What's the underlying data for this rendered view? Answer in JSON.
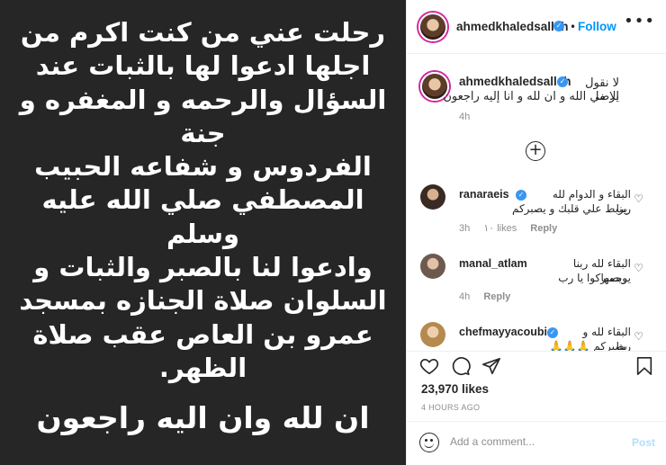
{
  "post": {
    "image_text": [
      "رحلت عني من كنت اكرم من",
      "اجلها ادعوا لها بالثبات عند",
      "السؤال والرحمه و المغفره و جنة",
      "الفردوس و شفاعه الحبيب",
      "المصطفي صلي الله عليه وسلم",
      "وادعوا لنا بالصبر والثبات و",
      "السلوان صلاة الجنازه بمسجد",
      "عمرو بن العاص عقب صلاة",
      "الظهر."
    ],
    "image_closing": "ان لله وان اليه راجعون"
  },
  "header": {
    "username": "ahmedkhaledsalleh",
    "separator": "•",
    "follow_label": "Follow",
    "more_icon": "more-horizontal-icon"
  },
  "caption": {
    "username": "ahmedkhaledsalleh",
    "line1": "لا نقول الا ما",
    "line2": "يرضي الله و ان لله و انا إليه راجعون",
    "time": "4h"
  },
  "load_more_icon": "plus-circle-icon",
  "comments": [
    {
      "username": "ranaraeis",
      "line1": "البقاء و الدوام لله ربنا",
      "line2": "يربط علي قلبك و يصبركم",
      "time": "3h",
      "likes": "١٠ likes",
      "reply": "Reply"
    },
    {
      "username": "manal_atlam",
      "line1": "البقاء لله ربنا يرحمها",
      "line2": "ويصبركوا يا رب",
      "time": "4h",
      "reply": "Reply"
    },
    {
      "username": "chefmayyacoubi",
      "line1": "البقاء لله و ربنا",
      "line2": "يصبركم 🙏🙏🙏",
      "time": "",
      "reply": ""
    }
  ],
  "actions": {
    "likes": "23,970 likes",
    "posted_ago": "4 HOURS AGO",
    "icons": [
      "heart-icon",
      "comment-icon",
      "share-icon",
      "bookmark-icon"
    ]
  },
  "comment_box": {
    "placeholder": "Add a comment...",
    "post_label": "Post"
  },
  "colors": {
    "media_bg": "#262626",
    "accent": "#0095f6",
    "verified": "#3897f0",
    "muted": "#8e8e8e",
    "post_disabled": "#b2dffc"
  }
}
